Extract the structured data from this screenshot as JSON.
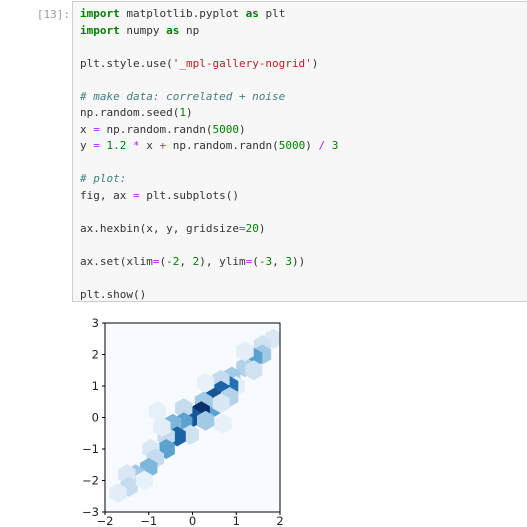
{
  "cell": {
    "prompt": "[13]:",
    "code_lines": [
      [
        {
          "t": "import",
          "c": "kw"
        },
        {
          "t": " matplotlib.pyplot "
        },
        {
          "t": "as",
          "c": "kw"
        },
        {
          "t": " plt"
        }
      ],
      [
        {
          "t": "import",
          "c": "kw"
        },
        {
          "t": " numpy "
        },
        {
          "t": "as",
          "c": "kw"
        },
        {
          "t": " np"
        }
      ],
      [],
      [
        {
          "t": "plt.style.use("
        },
        {
          "t": "'_mpl-gallery-nogrid'",
          "c": "str"
        },
        {
          "t": ")"
        }
      ],
      [],
      [
        {
          "t": "# make data: correlated + noise",
          "c": "cm"
        }
      ],
      [
        {
          "t": "np.random.seed("
        },
        {
          "t": "1",
          "c": "num"
        },
        {
          "t": ")"
        }
      ],
      [
        {
          "t": "x "
        },
        {
          "t": "=",
          "c": "op"
        },
        {
          "t": " np.random.randn("
        },
        {
          "t": "5000",
          "c": "num"
        },
        {
          "t": ")"
        }
      ],
      [
        {
          "t": "y "
        },
        {
          "t": "=",
          "c": "op"
        },
        {
          "t": " "
        },
        {
          "t": "1.2",
          "c": "num"
        },
        {
          "t": " "
        },
        {
          "t": "*",
          "c": "op"
        },
        {
          "t": " x "
        },
        {
          "t": "+",
          "c": "op"
        },
        {
          "t": " np.random.randn("
        },
        {
          "t": "5000",
          "c": "num"
        },
        {
          "t": ") "
        },
        {
          "t": "/",
          "c": "op"
        },
        {
          "t": " "
        },
        {
          "t": "3",
          "c": "num"
        }
      ],
      [],
      [
        {
          "t": "# plot:",
          "c": "cm"
        }
      ],
      [
        {
          "t": "fig, ax "
        },
        {
          "t": "=",
          "c": "op"
        },
        {
          "t": " plt.subplots()"
        }
      ],
      [],
      [
        {
          "t": "ax.hexbin(x, y, gridsize"
        },
        {
          "t": "=",
          "c": "op"
        },
        {
          "t": "20",
          "c": "num"
        },
        {
          "t": ")"
        }
      ],
      [],
      [
        {
          "t": "ax.set(xlim"
        },
        {
          "t": "=",
          "c": "op"
        },
        {
          "t": "("
        },
        {
          "t": "-2",
          "c": "num"
        },
        {
          "t": ", "
        },
        {
          "t": "2",
          "c": "num"
        },
        {
          "t": "), ylim"
        },
        {
          "t": "=",
          "c": "op"
        },
        {
          "t": "("
        },
        {
          "t": "-3",
          "c": "num"
        },
        {
          "t": ", "
        },
        {
          "t": "3",
          "c": "num"
        },
        {
          "t": "))"
        }
      ],
      [],
      [
        {
          "t": "plt.show()"
        }
      ]
    ]
  },
  "chart_data": {
    "type": "heatmap",
    "subtype": "hexbin",
    "title": "",
    "xlabel": "",
    "ylabel": "",
    "xlim": [
      -2,
      2
    ],
    "ylim": [
      -3,
      3
    ],
    "x_ticks": [
      "−2",
      "−1",
      "0",
      "1",
      "2"
    ],
    "y_ticks": [
      "3",
      "2",
      "1",
      "0",
      "−1",
      "−2",
      "−3"
    ],
    "grid": false,
    "colormap": "Blues",
    "background_color": "#f7fbff",
    "bins": [
      {
        "x": 1.85,
        "y": 2.5,
        "d": 0.15
      },
      {
        "x": 1.6,
        "y": 2.3,
        "d": 0.2
      },
      {
        "x": 1.6,
        "y": 2.0,
        "d": 0.35
      },
      {
        "x": 1.4,
        "y": 1.9,
        "d": 0.55
      },
      {
        "x": 1.2,
        "y": 1.6,
        "d": 0.3
      },
      {
        "x": 1.4,
        "y": 1.5,
        "d": 0.2
      },
      {
        "x": 1.2,
        "y": 2.1,
        "d": 0.1
      },
      {
        "x": 0.9,
        "y": 1.3,
        "d": 0.35
      },
      {
        "x": 1.0,
        "y": 1.0,
        "d": 0.1
      },
      {
        "x": 0.85,
        "y": 1.0,
        "d": 0.75
      },
      {
        "x": 0.65,
        "y": 1.2,
        "d": 0.25
      },
      {
        "x": 0.65,
        "y": 0.85,
        "d": 0.8
      },
      {
        "x": 0.85,
        "y": 0.65,
        "d": 0.3
      },
      {
        "x": 0.45,
        "y": 0.65,
        "d": 0.85
      },
      {
        "x": 0.45,
        "y": 0.3,
        "d": 0.55
      },
      {
        "x": 0.65,
        "y": 0.45,
        "d": 0.15
      },
      {
        "x": 0.25,
        "y": 0.5,
        "d": 0.35
      },
      {
        "x": 0.2,
        "y": 0.2,
        "d": 1.0
      },
      {
        "x": 0.0,
        "y": 0.0,
        "d": 0.85
      },
      {
        "x": 0.3,
        "y": -0.1,
        "d": 0.35
      },
      {
        "x": -0.2,
        "y": 0.3,
        "d": 0.25
      },
      {
        "x": -0.2,
        "y": -0.15,
        "d": 0.55
      },
      {
        "x": -0.05,
        "y": -0.55,
        "d": 0.2
      },
      {
        "x": -0.45,
        "y": -0.2,
        "d": 0.45
      },
      {
        "x": -0.35,
        "y": -0.6,
        "d": 0.8
      },
      {
        "x": -0.6,
        "y": -0.6,
        "d": 0.25
      },
      {
        "x": -0.6,
        "y": -1.0,
        "d": 0.55
      },
      {
        "x": -0.95,
        "y": -1.0,
        "d": 0.15
      },
      {
        "x": -0.85,
        "y": -1.3,
        "d": 0.25
      },
      {
        "x": -1.0,
        "y": -1.6,
        "d": 0.45
      },
      {
        "x": -1.3,
        "y": -1.8,
        "d": 0.35
      },
      {
        "x": -1.5,
        "y": -1.8,
        "d": 0.15
      },
      {
        "x": -1.45,
        "y": -2.2,
        "d": 0.25
      },
      {
        "x": -1.7,
        "y": -2.4,
        "d": 0.1
      },
      {
        "x": -1.1,
        "y": -2.0,
        "d": 0.08
      },
      {
        "x": -0.8,
        "y": 0.2,
        "d": 0.08
      },
      {
        "x": 0.7,
        "y": -0.2,
        "d": 0.08
      },
      {
        "x": -0.7,
        "y": -0.3,
        "d": 0.1
      },
      {
        "x": 0.3,
        "y": 1.1,
        "d": 0.08
      }
    ]
  }
}
